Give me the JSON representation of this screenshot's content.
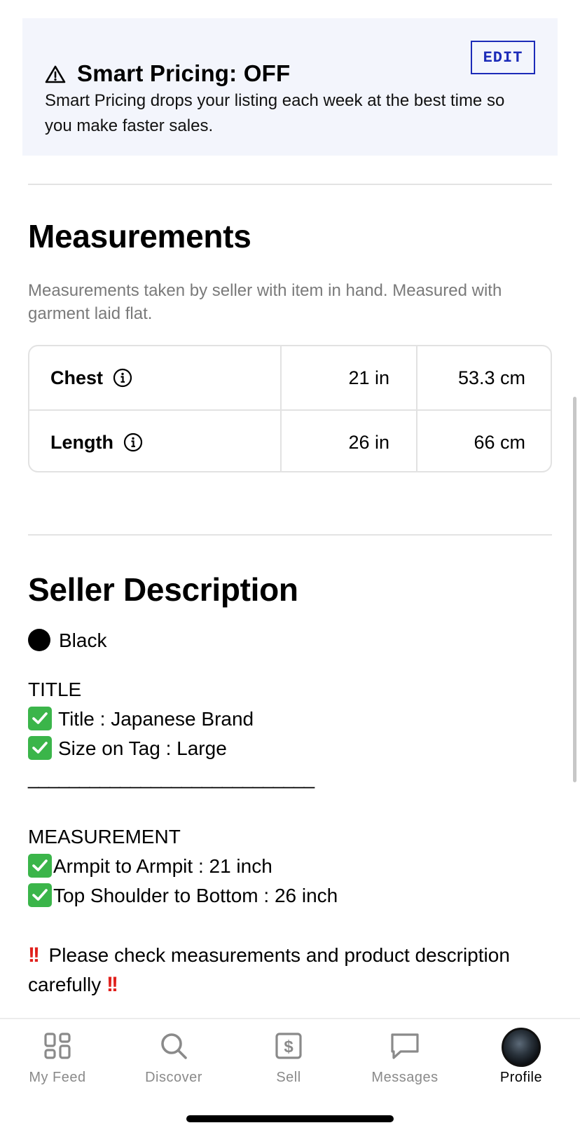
{
  "smart_pricing": {
    "title": "Smart Pricing: OFF",
    "edit_label": "EDIT",
    "description": "Smart Pricing drops your listing each week at the best time so you make faster sales."
  },
  "measurements": {
    "heading": "Measurements",
    "note": "Measurements taken by seller with item in hand. Measured with garment laid flat.",
    "rows": [
      {
        "label": "Chest",
        "inches": "21 in",
        "cm": "53.3 cm"
      },
      {
        "label": "Length",
        "inches": "26 in",
        "cm": "66 cm"
      }
    ]
  },
  "seller_description": {
    "heading": "Seller Description",
    "color": "Black",
    "color_swatch": "#000000",
    "title_header": "TITLE",
    "title_line": "Title : Japanese Brand",
    "size_line": "Size on Tag : Large",
    "separator": "____________________________",
    "measurement_header": "MEASUREMENT",
    "armpit_line": "Armpit to Armpit : 21 inch",
    "shoulder_line": "Top Shoulder to Bottom : 26 inch",
    "warning_line_1": "Please check measurements and product description",
    "warning_line_2": "carefully"
  },
  "tabs": [
    {
      "label": "My Feed",
      "icon": "grid-icon"
    },
    {
      "label": "Discover",
      "icon": "search-icon"
    },
    {
      "label": "Sell",
      "icon": "dollar-tag-icon"
    },
    {
      "label": "Messages",
      "icon": "chat-bubble-icon"
    },
    {
      "label": "Profile",
      "icon": "avatar"
    }
  ],
  "colors": {
    "accent": "#1c2bb8",
    "banner_bg": "#f3f5fc",
    "check_green": "#3bb54a",
    "bang_red": "#e0201c"
  }
}
